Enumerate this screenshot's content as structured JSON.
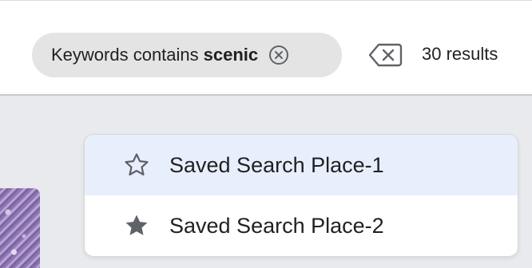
{
  "filter_chip": {
    "prefix": "Keywords contains",
    "keyword": "scenic",
    "remove_icon": "circle-x-icon"
  },
  "toolbar": {
    "clear_icon": "backspace-clear-icon",
    "results_text": "30 results"
  },
  "saved_searches": {
    "items": [
      {
        "label": "Saved Search Place-1",
        "icon": "star-outline-icon"
      },
      {
        "label": "Saved Search Place-2",
        "icon": "star-filled-icon"
      }
    ]
  },
  "colors": {
    "chip_bg": "#e4e4e4",
    "highlight": "#e8effc",
    "page_bg": "#e8eaed",
    "icon": "#5f6368"
  }
}
